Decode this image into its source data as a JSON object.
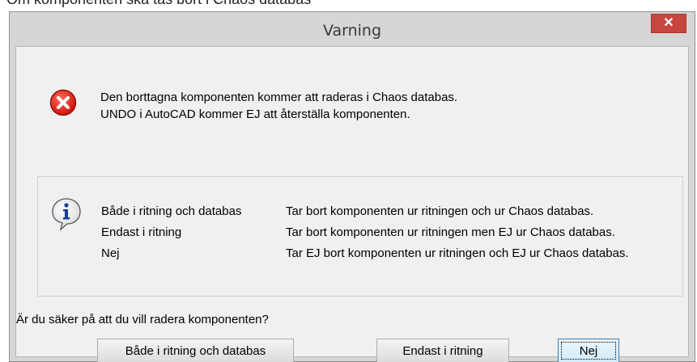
{
  "window": {
    "title": "Varning",
    "close_glyph": "✕",
    "close_icon": "close-icon",
    "backdrop_text": "Om komponenten ska tas bort i Chaos databas"
  },
  "warning": {
    "icon": "error-icon",
    "icon_color": "#d9261c",
    "line1": "Den borttagna komponenten kommer att raderas i Chaos databas.",
    "line2": "UNDO i AutoCAD kommer EJ att återställa komponenten."
  },
  "info": {
    "icon": "info-icon",
    "options": [
      {
        "name": "Både i ritning och databas",
        "description": "Tar bort komponenten ur ritningen och ur Chaos databas."
      },
      {
        "name": "Endast i ritning",
        "description": "Tar bort komponenten ur ritningen men EJ ur Chaos databas."
      },
      {
        "name": "Nej",
        "description": "Tar EJ bort komponenten ur ritningen och EJ ur Chaos databas."
      }
    ]
  },
  "question": "Är du säker på att du vill radera komponenten?",
  "buttons": {
    "both": "Både i ritning och databas",
    "drawing_only": "Endast i ritning",
    "no": "Nej"
  },
  "colors": {
    "close_button": "#c7463f",
    "dialog_frame": "#d6d6d6",
    "client_area": "#f0f0f0"
  }
}
